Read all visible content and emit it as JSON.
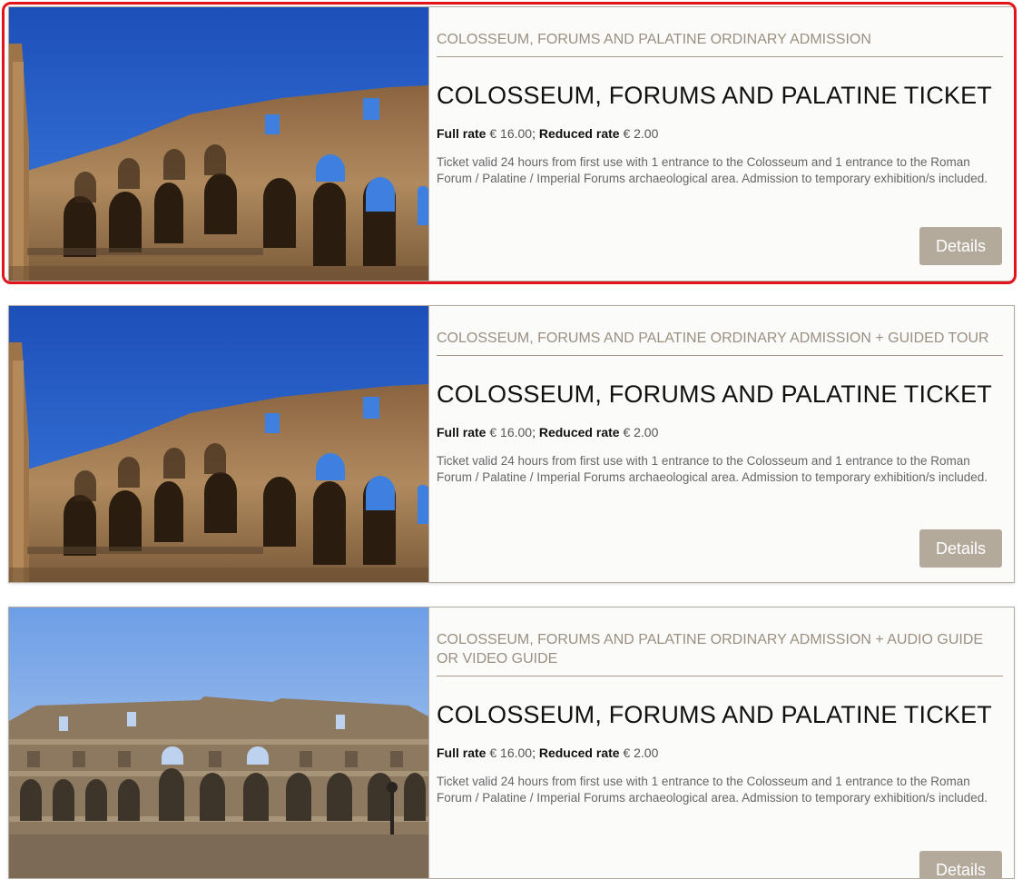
{
  "cards": [
    {
      "category": "COLOSSEUM, FORUMS AND PALATINE ORDINARY ADMISSION",
      "title": "COLOSSEUM, FORUMS AND PALATINE TICKET",
      "full_rate_label": "Full rate",
      "full_rate_value": "€ 16.00",
      "separator": ";",
      "reduced_rate_label": "Reduced rate",
      "reduced_rate_value": "€ 2.00",
      "description": "Ticket valid 24 hours from first use with 1 entrance to the Colosseum and 1 entrance to the Roman Forum / Palatine / Imperial Forums archaeological area. Admission to temporary exhibition/s included.",
      "button_label": "Details",
      "image": "colosseum-photo"
    },
    {
      "category": "COLOSSEUM, FORUMS AND PALATINE ORDINARY ADMISSION + GUIDED TOUR",
      "title": "COLOSSEUM, FORUMS AND PALATINE TICKET",
      "full_rate_label": "Full rate",
      "full_rate_value": "€ 16.00",
      "separator": ";",
      "reduced_rate_label": "Reduced rate",
      "reduced_rate_value": "€ 2.00",
      "description": "Ticket valid 24 hours from first use with 1 entrance to the Colosseum and 1 entrance to the Roman Forum / Palatine / Imperial Forums archaeological area. Admission to temporary exhibition/s included.",
      "button_label": "Details",
      "image": "colosseum-photo"
    },
    {
      "category": "COLOSSEUM, FORUMS AND PALATINE ORDINARY ADMISSION + AUDIO GUIDE OR VIDEO GUIDE",
      "title": "COLOSSEUM, FORUMS AND PALATINE TICKET",
      "full_rate_label": "Full rate",
      "full_rate_value": "€ 16.00",
      "separator": ";",
      "reduced_rate_label": "Reduced rate",
      "reduced_rate_value": "€ 2.00",
      "description": "Ticket valid 24 hours from first use with 1 entrance to the Colosseum and 1 entrance to the Roman Forum / Palatine / Imperial Forums archaeological area. Admission to temporary exhibition/s included.",
      "button_label": "Details",
      "image": "colosseum-exterior-photo"
    }
  ],
  "colors": {
    "accent_button": "#b3aa9c",
    "category_text": "#9a8f80",
    "highlight_border": "#e3131b"
  }
}
